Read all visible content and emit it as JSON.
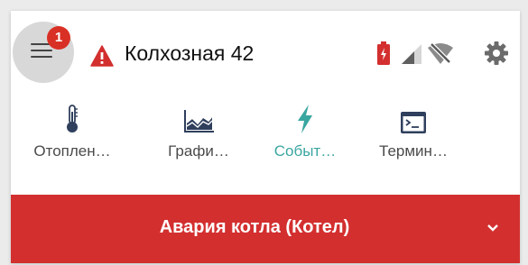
{
  "header": {
    "menu_badge_count": "1",
    "device_name": "Колхозная 42",
    "alert_icon": "warning-triangle-icon",
    "status_icons": [
      "battery-alert-icon",
      "cellular-signal-icon",
      "wifi-off-icon",
      "gear-icon"
    ]
  },
  "tabs": [
    {
      "label": "Отоплен…",
      "icon": "thermometer-icon",
      "active": false
    },
    {
      "label": "Графи…",
      "icon": "area-chart-icon",
      "active": false
    },
    {
      "label": "Событ…",
      "icon": "lightning-icon",
      "active": true
    },
    {
      "label": "Термин…",
      "icon": "terminal-icon",
      "active": false
    }
  ],
  "alert_banner": {
    "text": "Авария котла (Котел)",
    "icon": "chevron-down-icon"
  },
  "colors": {
    "accent": "#3aa6a0",
    "alert_red": "#d32f2f",
    "badge_red": "#d93025",
    "menu_circle": "#d8d8d8"
  }
}
